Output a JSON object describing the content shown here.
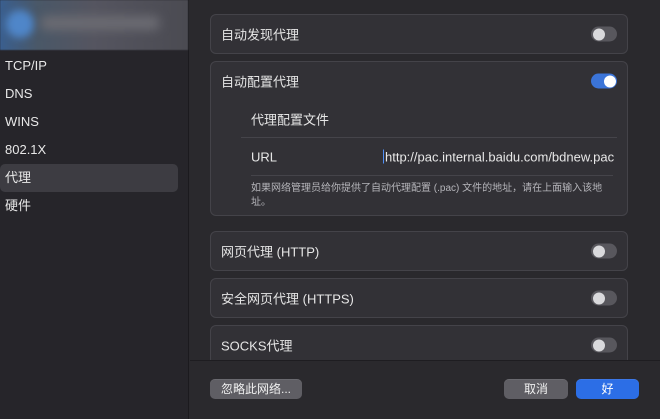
{
  "sidebar": {
    "items": [
      {
        "label": "TCP/IP"
      },
      {
        "label": "DNS"
      },
      {
        "label": "WINS"
      },
      {
        "label": "802.1X"
      },
      {
        "label": "代理"
      },
      {
        "label": "硬件"
      }
    ],
    "selected_index": 4
  },
  "proxy": {
    "auto_discovery": {
      "label": "自动发现代理",
      "enabled": false
    },
    "auto_config": {
      "label": "自动配置代理",
      "enabled": true,
      "file_label": "代理配置文件",
      "url_label": "URL",
      "url_value": "http://pac.internal.baidu.com/bdnew.pac",
      "help_text": "如果网络管理员给你提供了自动代理配置 (.pac) 文件的地址，请在上面输入该地址。"
    },
    "http": {
      "label": "网页代理 (HTTP)",
      "enabled": false
    },
    "https": {
      "label": "安全网页代理 (HTTPS)",
      "enabled": false
    },
    "socks": {
      "label": "SOCKS代理",
      "enabled": false
    }
  },
  "footer": {
    "ignore_button": "忽略此网络...",
    "cancel_button": "取消",
    "ok_button": "好"
  },
  "colors": {
    "accent": "#2c6ee6",
    "toggle_on": "#3b74d8"
  }
}
